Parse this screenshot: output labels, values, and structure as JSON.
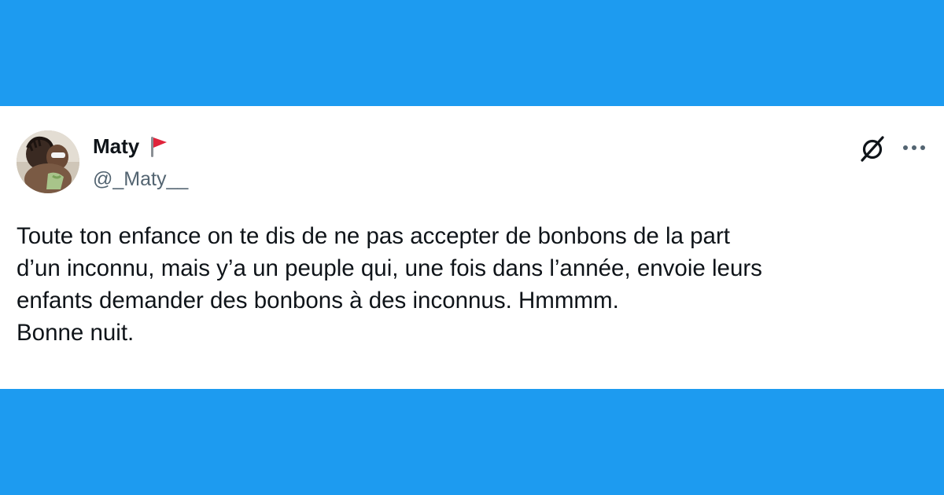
{
  "tweet": {
    "author": {
      "display_name": "Maty",
      "name_emoji": "red-triangular-flag",
      "handle": "@_Maty__",
      "avatar": "user-photo"
    },
    "text": "Toute ton enfance on te dis de ne pas accepter de bonbons de la part\nd’un inconnu, mais y’a un peuple qui, une fois dans l’année, envoie leurs\nenfants demander des bonbons à des inconnus. Hmmmm.\nBonne nuit.",
    "actions": {
      "grok_icon": "grok-icon",
      "more_icon": "more-options-icon"
    }
  },
  "colors": {
    "background": "#1d9bf0",
    "card": "#ffffff",
    "text_primary": "#0f1419",
    "text_secondary": "#536471",
    "flag_red": "#e0243b"
  }
}
